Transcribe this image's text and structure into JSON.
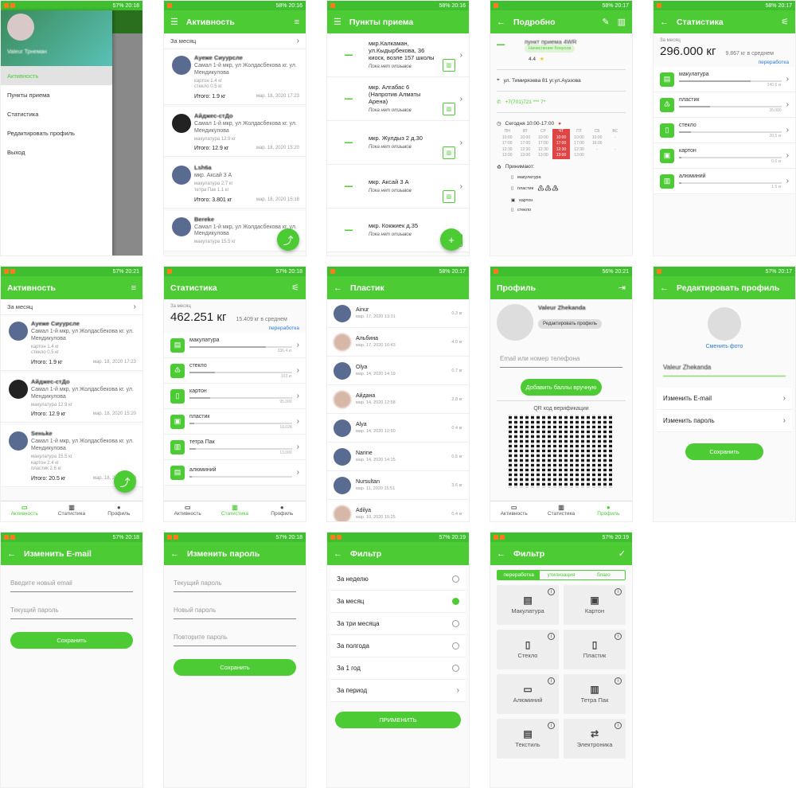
{
  "status": {
    "s1": "57% 20:18",
    "s2": "58% 20:16",
    "s3": "58% 20:16",
    "s4": "58% 20:17",
    "s5": "58% 20:17",
    "s6": "57% 20:21",
    "s7": "57% 20:18",
    "s8": "58% 20:17",
    "s9": "56% 20:21",
    "s10": "57% 20:17",
    "s11": "57% 20:18",
    "s12": "57% 20:18",
    "s13": "57% 20:19",
    "s14": "57% 20:19"
  },
  "drawer": {
    "name": "Valeur Трнеман",
    "items": [
      "Активность",
      "Пункты приема",
      "Статистика",
      "Редактировать профиль",
      "Выход"
    ]
  },
  "activity": {
    "title": "Активность",
    "period": "За месяц",
    "cards": [
      {
        "name": "Ауеже Сиуурсле",
        "addr": "Самал 1-й мкр, ул Жолдасбекова кг. ул. Мендикулова",
        "items": "картон 1.4 кг\nстекло 0.5 кг",
        "total": "Итого: 1.9 кг",
        "date": "мар. 18, 2020 17:23"
      },
      {
        "name": "Айджес-стДо",
        "addr": "Самал 1-й мкр, ул Жолдасбекова кг. ул. Мендикулова",
        "items": "макулатура 12.9 кг",
        "total": "Итого: 12.9 кг",
        "date": "мар. 18, 2020 15:20"
      },
      {
        "name": "Lsh6a",
        "addr": "мкр. Аксай 3 А",
        "items": "макулатура 2.7 кг\nтетра Пак 1.1 кг",
        "total": "Итого: 3.801 кг",
        "date": "мар. 18, 2020 15:18"
      },
      {
        "name": "Bereke",
        "addr": "Самал 1-й мкр, ул Жолдасбекова кг. ул. Мендикулова",
        "items": "макулатура 15.5 кг",
        "total": "",
        "date": ""
      }
    ]
  },
  "points": {
    "title": "Пункты приема",
    "no_reviews": "Пока нет отзывов",
    "items": [
      "мкр.Калкаман, ул.Кыдырбекова, 36 киоск, возле 157 школы",
      "мкр. Алгабас 6 (Напротив Алматы Арена)",
      "мкр. Жулдыз 2 д.30",
      "мкр. Аксай 3 А",
      "мкр. Кокжиек д.35"
    ]
  },
  "detail": {
    "title": "Подробно",
    "name": "пункт приема 4WR",
    "bonus": "Начисление бонусов",
    "rating": "4.4",
    "address": "ул. Тимирязева 81 уг.ул.Ауэзова",
    "phone": "+7(701)721 *** 7*",
    "today": "Сегодня 10:00-17:00",
    "days": [
      "ПН",
      "ВТ",
      "СР",
      "ЧТ",
      "ПТ",
      "СБ",
      "ВС"
    ],
    "accepts": "Принимают:",
    "acc_items": [
      "макулатура",
      "пластик",
      "картон",
      "стекло"
    ]
  },
  "stats1": {
    "title": "Статистика",
    "period": "За месяц",
    "total": "296.000 кг",
    "avg": "9.867 кг в среднем",
    "link": "переработка",
    "rows": [
      {
        "n": "макулатура",
        "v": "240.6 кг",
        "f": 0.7
      },
      {
        "n": "пластик",
        "v": "35.000",
        "f": 0.3
      },
      {
        "n": "стекло",
        "v": "20.5 кг",
        "f": 0.12
      },
      {
        "n": "картон",
        "v": "0.0 кг",
        "f": 0.02
      },
      {
        "n": "алюминий",
        "v": "1.5 кг",
        "f": 0.02
      }
    ]
  },
  "activity2": {
    "title": "Активность",
    "period": "За месяц",
    "cards": [
      {
        "name": "Ауеже Сиуурсле",
        "addr": "Самал 1-й мкр, ул Жолдасбекова кг. ул. Мендикулова",
        "items": "картон 1.4 кг\nстекло 0.5 кг",
        "total": "Итого: 1.9 кг",
        "date": "мар. 18, 2020 17:23"
      },
      {
        "name": "Айджес-стДо",
        "addr": "Самал 1-й мкр, ул Жолдасбекова кг. ул. Мендикулова",
        "items": "макулатура 12.9 кг",
        "total": "Итого: 12.9 кг",
        "date": "мар. 18, 2020 15:20"
      },
      {
        "name": "Sеньkе",
        "addr": "Самал 1-й мкр, ул Жолдасбекова кг. ул. Мендикулова",
        "items": "макулатура 15.5 кг\nкартон 2.4 кг\nпластик 2.6 кг",
        "total": "Итого: 20.5 кг",
        "date": "мар. 18, 2020 15:20"
      }
    ]
  },
  "nav": {
    "a": "Активность",
    "s": "Статистика",
    "p": "Профиль"
  },
  "stats2": {
    "title": "Статистика",
    "period": "За месяц",
    "total": "462.251 кг",
    "avg": "15.409 кг в среднем",
    "link": "переработка",
    "rows": [
      {
        "n": "макулатура",
        "v": "336.4 кг",
        "f": 0.75
      },
      {
        "n": "стекло",
        "v": "103 кг",
        "f": 0.25
      },
      {
        "n": "картон",
        "v": "95.000",
        "f": 0.2
      },
      {
        "n": "пластик",
        "v": "10.028",
        "f": 0.05
      },
      {
        "n": "тетра Пак",
        "v": "13.000",
        "f": 0.06
      },
      {
        "n": "алюминий",
        "v": "",
        "f": 0.02
      }
    ]
  },
  "plastic": {
    "title": "Пластик",
    "rows": [
      {
        "n": "Ainur",
        "d": "мар. 17, 2020 13:31",
        "k": "0.3 кг"
      },
      {
        "n": "Альбина",
        "d": "мар. 17, 2020 16:43",
        "k": "4.0 кг"
      },
      {
        "n": "Olya",
        "d": "мар. 14, 2020 14:19",
        "k": "0.7 кг"
      },
      {
        "n": "Айдана",
        "d": "мар. 14, 2020 12:58",
        "k": "2.8 кг"
      },
      {
        "n": "Alya",
        "d": "мар. 14, 2020 12:50",
        "k": "0.4 кг"
      },
      {
        "n": "Narine",
        "d": "мар. 14, 2020 14:15",
        "k": "0.5 кг"
      },
      {
        "n": "Nursultan",
        "d": "мар. 11, 2020 15:51",
        "k": "3.6 кг"
      },
      {
        "n": "Adilya",
        "d": "мар. 10, 2020 15:25",
        "k": "0.4 кг"
      }
    ]
  },
  "profile": {
    "title": "Профиль",
    "name": "Valeur Zhekanda",
    "edit": "Редактировать профиль",
    "email_ph": "Email или номер телефона",
    "add": "Добавить баллы вручную",
    "qr": "QR код верификации"
  },
  "edit": {
    "title": "Редактировать профиль",
    "change_photo": "Сменить фото",
    "name": "Valeur Zhekanda",
    "email": "Изменить E-mail",
    "pass": "Изменить пароль",
    "save": "Сохранить"
  },
  "chemail": {
    "title": "Изменить E-mail",
    "ph1": "Введите новый email",
    "ph2": "Текущий пароль",
    "save": "Сохранить"
  },
  "chpass": {
    "title": "Изменить пароль",
    "ph1": "Текущий пароль",
    "ph2": "Новый пароль",
    "ph3": "Повторите пароль",
    "save": "Сохранить"
  },
  "filter": {
    "title": "Фильтр",
    "rows": [
      "За неделю",
      "За месяц",
      "За три месяца",
      "За полгода",
      "За 1 год",
      "За период"
    ],
    "apply": "ПРИМЕНИТЬ"
  },
  "filter2": {
    "title": "Фильтр",
    "tabs": [
      "переработка",
      "утилизация",
      "благо"
    ],
    "cells": [
      "Макулатура",
      "Картон",
      "Стекло",
      "Пластик",
      "Алюминий",
      "Тетра Пак",
      "Текстиль",
      "Электроника"
    ]
  }
}
